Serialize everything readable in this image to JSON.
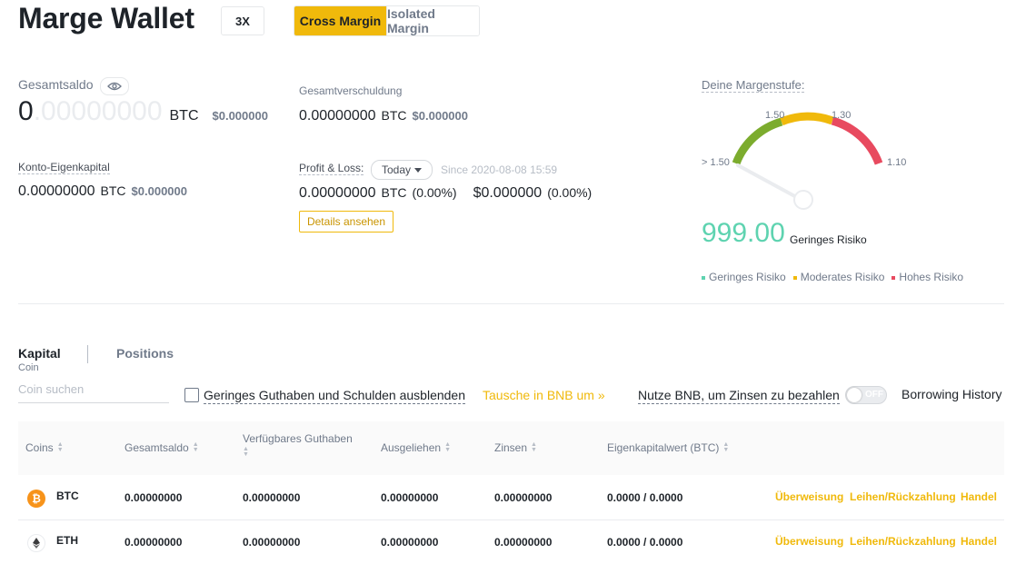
{
  "header": {
    "title": "Marge Wallet",
    "leverage": "3X",
    "tabs": [
      {
        "label": "Cross Margin",
        "active": true
      },
      {
        "label": "Isolated Margin",
        "active": false
      }
    ]
  },
  "balance": {
    "total_label": "Gesamtsaldo",
    "total_int": "0",
    "total_dec": ".00000000",
    "total_unit": "BTC",
    "total_usd": "$0.000000",
    "equity_label": "Konto-Eigenkapital",
    "equity_int": "0",
    "equity_dec": ".00000000",
    "equity_unit": "BTC",
    "equity_usd": "$0.000000",
    "debt_label": "Gesamtverschuldung",
    "debt_int": "0",
    "debt_dec": ".00000000",
    "debt_unit": "BTC",
    "debt_usd": "$0.000000"
  },
  "pnl": {
    "label": "Profit & Loss:",
    "period": "Today",
    "since": "Since 2020-08-08 15:59",
    "btc_value": "0.00000000",
    "btc_unit": "BTC",
    "btc_pct": "(0.00%)",
    "usd_value": "$0.000000",
    "usd_pct": "(0.00%)",
    "details_button": "Details ansehen"
  },
  "margin_level": {
    "label": "Deine Margenstufe:",
    "value": "999.00",
    "risk_text": "Geringes Risiko",
    "gauge_labels": {
      "left": "> 1.50",
      "mid_left": "1.50",
      "mid_right": "1.30",
      "right": "1.10"
    },
    "colors": {
      "low": "#7cac2e",
      "moderate": "#f0b90b",
      "high": "#e84a5f",
      "value": "#5ed3b0"
    },
    "legend": [
      {
        "label": "Geringes Risiko",
        "color": "#5ed3b0"
      },
      {
        "label": "Moderates Risiko",
        "color": "#f0b90b"
      },
      {
        "label": "Hohes Risiko",
        "color": "#e84a5f"
      }
    ]
  },
  "tabs": {
    "capital": "Kapital",
    "positions": "Positions",
    "capital_sub": "Coin"
  },
  "toolbar": {
    "search_placeholder": "Coin suchen",
    "hide_small_label": "Geringes Guthaben und Schulden ausblenden",
    "convert_bnb": "Tausche in BNB um »",
    "pay_bnb_label": "Nutze BNB, um Zinsen zu bezahlen",
    "toggle_state": "OFF",
    "borrowing_history": "Borrowing History"
  },
  "table": {
    "headers": [
      "Coins",
      "Gesamtsaldo",
      "Verfügbares Guthaben",
      "Ausgeliehen",
      "Zinsen",
      "Eigenkapitalwert (BTC)"
    ],
    "rows": [
      {
        "coin": "BTC",
        "icon": "bitcoin-icon",
        "total": "0.00000000",
        "available": "0.00000000",
        "borrowed": "0.00000000",
        "interest": "0.00000000",
        "equity": "0.0000 / 0.0000"
      },
      {
        "coin": "ETH",
        "icon": "ethereum-icon",
        "total": "0.00000000",
        "available": "0.00000000",
        "borrowed": "0.00000000",
        "interest": "0.00000000",
        "equity": "0.0000 / 0.0000"
      }
    ],
    "actions": [
      "Überweisung",
      "Leihen/Rückzahlung",
      "Handel"
    ]
  }
}
